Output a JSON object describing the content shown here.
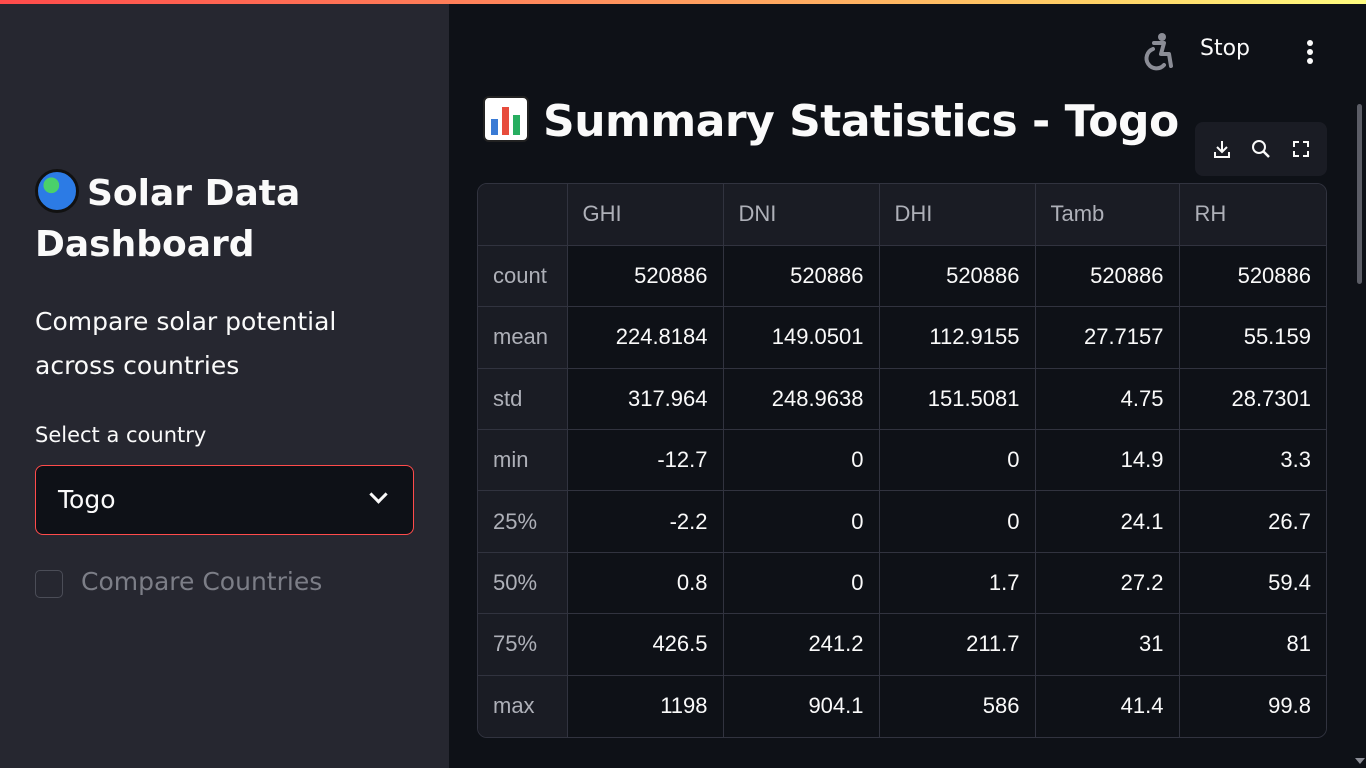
{
  "app": {
    "accent_color": "#ff4b4b",
    "stop_label": "Stop"
  },
  "sidebar": {
    "title": "Solar Data Dashboard",
    "title_icon": "globe-icon",
    "description": "Compare solar potential across countries",
    "select_label": "Select a country",
    "selected_country": "Togo",
    "compare_label": "Compare Countries",
    "compare_checked": false
  },
  "main": {
    "title": "Summary Statistics - Togo",
    "title_icon": "bar-chart-icon",
    "toolbar_icons": [
      "download-icon",
      "search-icon",
      "fullscreen-icon"
    ],
    "table": {
      "columns": [
        "",
        "GHI",
        "DNI",
        "DHI",
        "Tamb",
        "RH"
      ],
      "rows": [
        [
          "count",
          "520886",
          "520886",
          "520886",
          "520886",
          "520886"
        ],
        [
          "mean",
          "224.8184",
          "149.0501",
          "112.9155",
          "27.7157",
          "55.159"
        ],
        [
          "std",
          "317.964",
          "248.9638",
          "151.5081",
          "4.75",
          "28.7301"
        ],
        [
          "min",
          "-12.7",
          "0",
          "0",
          "14.9",
          "3.3"
        ],
        [
          "25%",
          "-2.2",
          "0",
          "0",
          "24.1",
          "26.7"
        ],
        [
          "50%",
          "0.8",
          "0",
          "1.7",
          "27.2",
          "59.4"
        ],
        [
          "75%",
          "426.5",
          "241.2",
          "211.7",
          "31",
          "81"
        ],
        [
          "max",
          "1198",
          "904.1",
          "586",
          "41.4",
          "99.8"
        ]
      ]
    }
  }
}
